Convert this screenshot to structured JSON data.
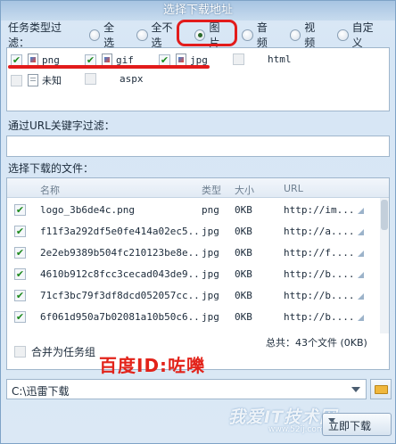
{
  "window": {
    "title": "选择下载地址"
  },
  "filter": {
    "label": "任务类型过滤：",
    "options": [
      {
        "label": "全选",
        "checked": false
      },
      {
        "label": "全不选",
        "checked": false
      },
      {
        "label": "图片",
        "checked": true
      },
      {
        "label": "音频",
        "checked": false
      },
      {
        "label": "视频",
        "checked": false
      },
      {
        "label": "自定义",
        "checked": false
      }
    ]
  },
  "types": [
    {
      "label": "png",
      "checked": true
    },
    {
      "label": "gif",
      "checked": true
    },
    {
      "label": "jpg",
      "checked": true
    },
    {
      "label": "html",
      "checked": false
    },
    {
      "label": "未知",
      "checked": false
    },
    {
      "label": "aspx",
      "checked": false
    }
  ],
  "url_filter": {
    "label": "通过URL关键字过滤：",
    "value": ""
  },
  "file_list": {
    "label": "选择下载的文件：",
    "columns": {
      "name": "名称",
      "type": "类型",
      "size": "大小",
      "url": "URL"
    },
    "rows": [
      {
        "name": "logo_3b6de4c.png",
        "type": "png",
        "size": "0KB",
        "url": "http://im...",
        "checked": true
      },
      {
        "name": "f11f3a292df5e0fe414a02ec5...",
        "type": "jpg",
        "size": "0KB",
        "url": "http://a....",
        "checked": true
      },
      {
        "name": "2e2eb9389b504fc210123be8e...",
        "type": "jpg",
        "size": "0KB",
        "url": "http://f....",
        "checked": true
      },
      {
        "name": "4610b912c8fcc3cecad043de9...",
        "type": "jpg",
        "size": "0KB",
        "url": "http://b....",
        "checked": true
      },
      {
        "name": "71cf3bc79f3df8dcd052057cc...",
        "type": "jpg",
        "size": "0KB",
        "url": "http://b....",
        "checked": true
      },
      {
        "name": "6f061d950a7b02081a10b50c6...",
        "type": "jpg",
        "size": "0KB",
        "url": "http://b....",
        "checked": true
      }
    ],
    "merge_label": "合并为任务组",
    "total": "总共：43个文件 (0KB)"
  },
  "watermark": "百度ID:咗嚛",
  "save_path": {
    "value": "C:\\迅雷下载"
  },
  "download_button": {
    "label": "立即下载"
  },
  "site_mark": {
    "text": "我爱IT技术网",
    "sub": "www.52ij.com"
  },
  "colors": {
    "highlight": "#e21b1b",
    "check": "#1e8a1e"
  }
}
